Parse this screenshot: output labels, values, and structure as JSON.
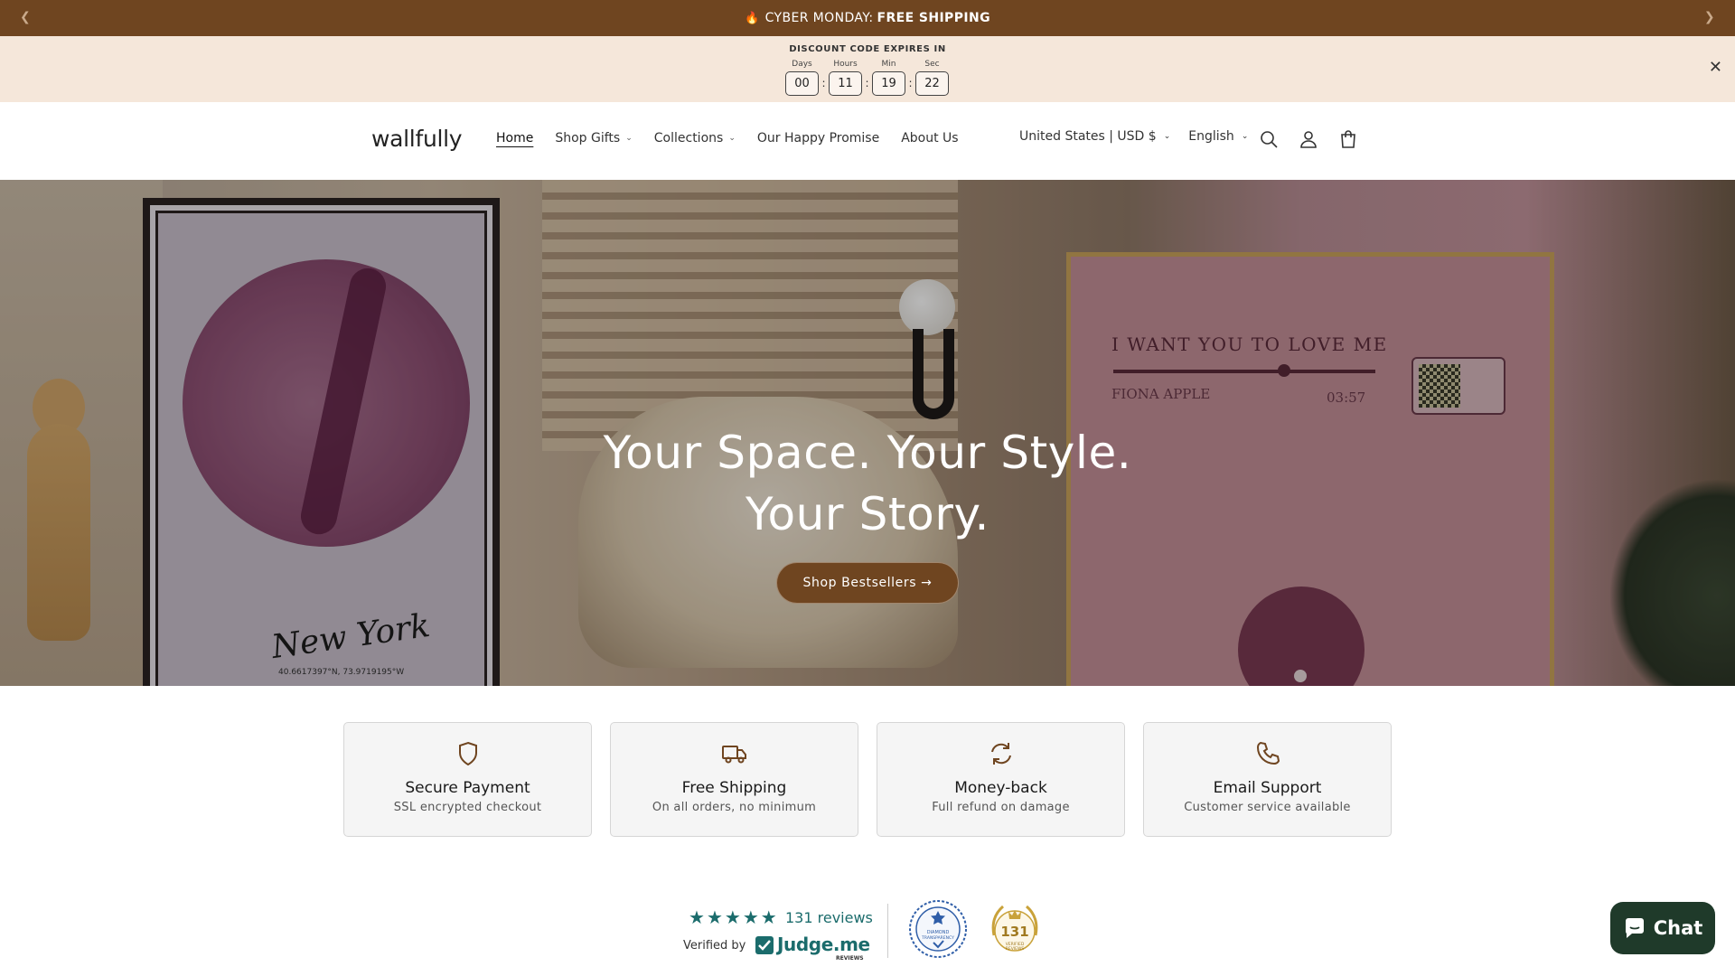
{
  "announcement": {
    "prefix": "CYBER MONDAY:",
    "highlight": "FREE SHIPPING",
    "fire_icon": "🔥",
    "prev_icon": "chevron-left-icon",
    "next_icon": "chevron-right-icon"
  },
  "countdown": {
    "title": "DISCOUNT CODE EXPIRES IN",
    "units": [
      {
        "label": "Days",
        "value": "00"
      },
      {
        "label": "Hours",
        "value": "11"
      },
      {
        "label": "Min",
        "value": "19"
      },
      {
        "label": "Sec",
        "value": "22"
      }
    ],
    "separator": ":",
    "close_icon": "✕"
  },
  "header": {
    "logo": "wallfully",
    "nav": [
      {
        "label": "Home",
        "active": true
      },
      {
        "label": "Shop Gifts",
        "dropdown": true
      },
      {
        "label": "Collections",
        "dropdown": true
      },
      {
        "label": "Our Happy Promise"
      },
      {
        "label": "About Us"
      }
    ],
    "country": "United States | USD $",
    "language": "English",
    "icons": [
      "search-icon",
      "account-icon",
      "cart-icon"
    ]
  },
  "hero": {
    "line1": "Your Space. Your Style.",
    "line2": "Your Story.",
    "cta": "Shop Bestsellers →",
    "poster_city": "New York",
    "poster_coords": "40.6617397°N, 73.9719195°W",
    "song_title": "I WANT YOU TO LOVE ME",
    "song_artist": "FIONA APPLE",
    "song_time": "03:57"
  },
  "features": [
    {
      "icon": "shield-icon",
      "title": "Secure Payment",
      "subtitle": "SSL encrypted checkout"
    },
    {
      "icon": "truck-icon",
      "title": "Free Shipping",
      "subtitle": "On all orders, no minimum"
    },
    {
      "icon": "refresh-icon",
      "title": "Money-back",
      "subtitle": "Full refund on damage"
    },
    {
      "icon": "phone-icon",
      "title": "Email Support",
      "subtitle": "Customer service available"
    }
  ],
  "reviews": {
    "rating_stars": 5,
    "count_text": "131 reviews",
    "verified_by": "Verified by",
    "brand": "Judge.me",
    "brand_sub": "REVIEWS",
    "badge_diamond": "DIAMOND TRANSPARENCY",
    "badge_count": "131",
    "badge_verified": "VERIFIED REVIEWS",
    "accent": "#1b6c6c"
  },
  "chat": {
    "label": "Chat"
  },
  "colors": {
    "brand_brown": "#6f4520",
    "countdown_bg": "#f5e7da"
  }
}
